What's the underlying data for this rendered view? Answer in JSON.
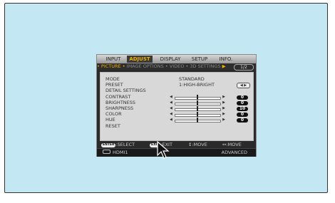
{
  "menu": {
    "tabs": [
      {
        "label": "INPUT"
      },
      {
        "label": "ADJUST",
        "active": true
      },
      {
        "label": "DISPLAY"
      },
      {
        "label": "SETUP"
      },
      {
        "label": "INFO."
      }
    ],
    "subtabs": {
      "items": [
        "PICTURE",
        "IMAGE OPTIONS",
        "VIDEO",
        "3D SETTINGS"
      ],
      "page": "1/2"
    },
    "rows": [
      {
        "label": "MODE",
        "value": "STANDARD"
      },
      {
        "label": "PRESET",
        "value": "1:HIGH-BRIGHT"
      },
      {
        "label": "DETAIL SETTINGS"
      },
      {
        "label": "CONTRAST",
        "value": "0",
        "level": 0.5
      },
      {
        "label": "BRIGHTNESS",
        "value": "0",
        "level": 0.5
      },
      {
        "label": "SHARPNESS",
        "value": "10",
        "level": 0.5
      },
      {
        "label": "COLOR",
        "value": "0",
        "level": 0.5
      },
      {
        "label": "HUE",
        "value": "0",
        "level": 0.5
      },
      {
        "label": "RESET"
      }
    ],
    "footer": {
      "enter_key": "ENTER",
      "select": ":SELECT",
      "exit_key": "EXIT",
      "exit": ":EXIT",
      "move_vert": "↕:MOVE",
      "move_horiz": "↔:MOVE"
    },
    "status": {
      "input": "HDMI1",
      "mode": "ADVANCED"
    }
  },
  "colors": {
    "accent": "#f0b000",
    "background": "#c4e7f4"
  }
}
